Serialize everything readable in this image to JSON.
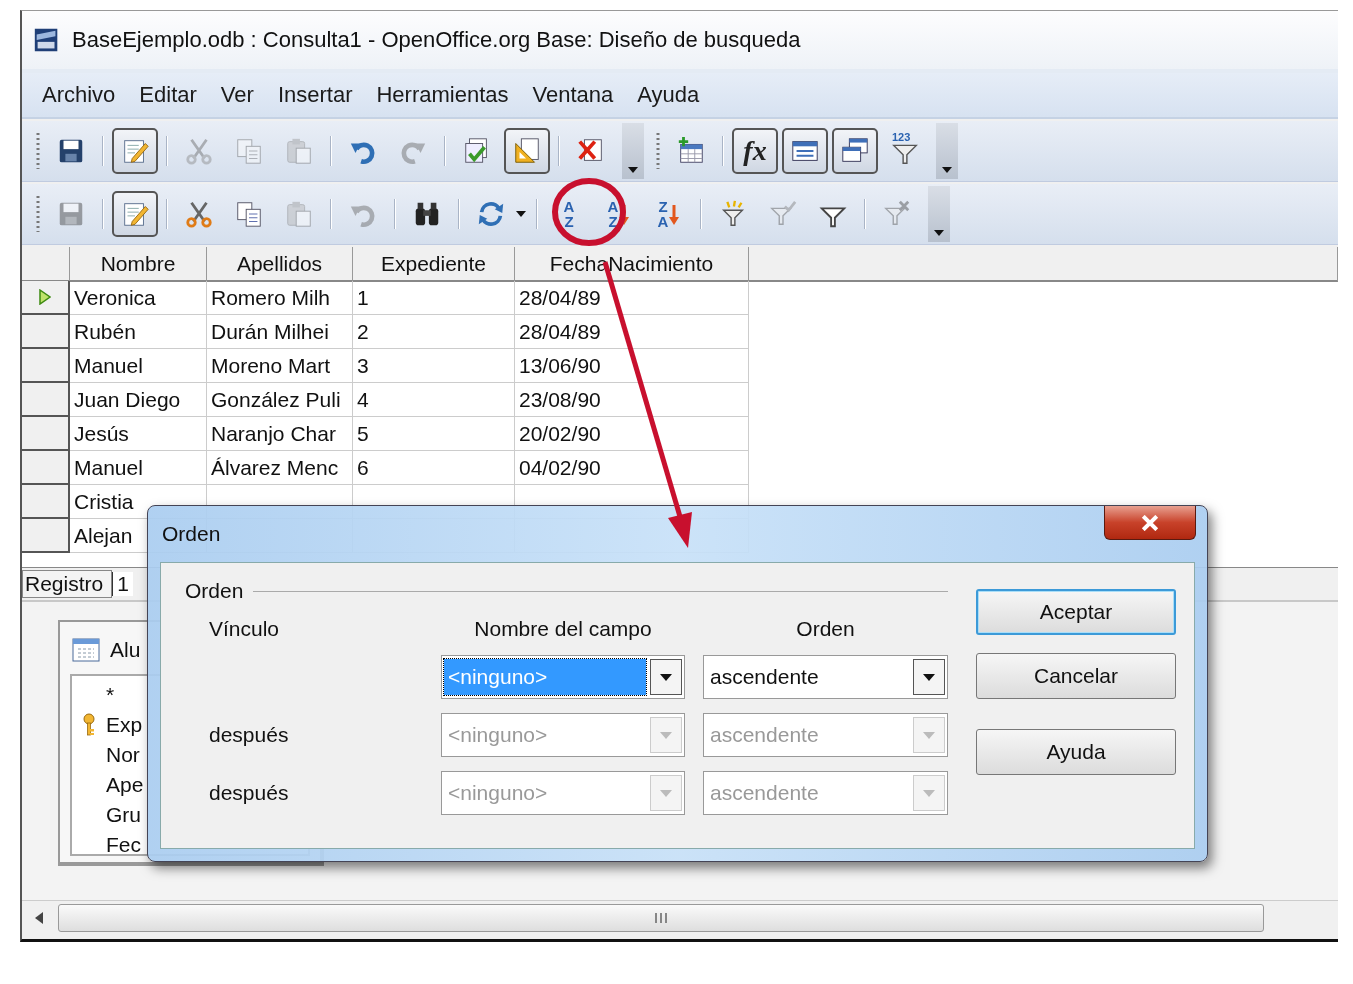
{
  "window": {
    "title": "BaseEjemplo.odb : Consulta1 - OpenOffice.org Base: Diseño de busqueda"
  },
  "menu": [
    "Archivo",
    "Editar",
    "Ver",
    "Insertar",
    "Herramientas",
    "Ventana",
    "Ayuda"
  ],
  "toolbars": [
    [
      {
        "kind": "grip"
      },
      {
        "kind": "save",
        "on": false,
        "disabled": false
      },
      {
        "kind": "separator"
      },
      {
        "kind": "edit",
        "on": true,
        "disabled": false
      },
      {
        "kind": "separator"
      },
      {
        "kind": "cut",
        "on": false,
        "disabled": true
      },
      {
        "kind": "copy",
        "on": false,
        "disabled": true
      },
      {
        "kind": "paste",
        "on": false,
        "disabled": true
      },
      {
        "kind": "separator"
      },
      {
        "kind": "undo",
        "on": false,
        "disabled": false
      },
      {
        "kind": "redo",
        "on": false,
        "disabled": true
      },
      {
        "kind": "separator"
      },
      {
        "kind": "run",
        "on": false,
        "disabled": false
      },
      {
        "kind": "design",
        "on": true,
        "disabled": false
      },
      {
        "kind": "separator"
      },
      {
        "kind": "delete",
        "on": false,
        "disabled": false
      },
      {
        "kind": "overflow"
      },
      {
        "kind": "grip"
      },
      {
        "kind": "addtable",
        "on": false,
        "disabled": false
      },
      {
        "kind": "separator"
      },
      {
        "kind": "function",
        "on": true,
        "disabled": false,
        "glyphs": [
          "fx"
        ]
      },
      {
        "kind": "alias",
        "on": true,
        "disabled": false
      },
      {
        "kind": "tablename",
        "on": true,
        "disabled": false
      },
      {
        "kind": "numfilter",
        "on": false,
        "disabled": false,
        "glyphs": [
          "123"
        ]
      },
      {
        "kind": "overflow"
      }
    ],
    [
      {
        "kind": "grip"
      },
      {
        "kind": "save",
        "on": false,
        "disabled": true
      },
      {
        "kind": "separator"
      },
      {
        "kind": "edit",
        "on": true,
        "disabled": false
      },
      {
        "kind": "separator"
      },
      {
        "kind": "cut",
        "on": false,
        "disabled": false
      },
      {
        "kind": "copy",
        "on": false,
        "disabled": false
      },
      {
        "kind": "paste",
        "on": false,
        "disabled": true
      },
      {
        "kind": "separator"
      },
      {
        "kind": "undo",
        "on": false,
        "disabled": true
      },
      {
        "kind": "separator"
      },
      {
        "kind": "find",
        "on": false,
        "disabled": false
      },
      {
        "kind": "separator"
      },
      {
        "kind": "refresh",
        "on": false,
        "disabled": false
      },
      {
        "kind": "dropdown"
      },
      {
        "kind": "separator"
      },
      {
        "kind": "sort",
        "on": false,
        "disabled": false,
        "glyphs": [
          "A",
          "Z"
        ]
      },
      {
        "kind": "sortasc",
        "on": false,
        "disabled": false,
        "glyphs": [
          "A",
          "Z"
        ]
      },
      {
        "kind": "sortdesc",
        "on": false,
        "disabled": false,
        "glyphs": [
          "Z",
          "A"
        ]
      },
      {
        "kind": "separator"
      },
      {
        "kind": "autofilter",
        "on": false,
        "disabled": false
      },
      {
        "kind": "stdfilter",
        "on": false,
        "disabled": true
      },
      {
        "kind": "filter",
        "on": false,
        "disabled": false
      },
      {
        "kind": "separator"
      },
      {
        "kind": "removefilter",
        "on": false,
        "disabled": true
      },
      {
        "kind": "overflow"
      }
    ]
  ],
  "grid": {
    "columns": [
      "Nombre",
      "Apellidos",
      "Expediente",
      "FechaNacimiento"
    ],
    "rows": [
      {
        "current": true,
        "cells": [
          "Veronica",
          "Romero Milh",
          "1",
          "28/04/89"
        ]
      },
      {
        "current": false,
        "cells": [
          "Rubén",
          "Durán Milhei",
          "2",
          "28/04/89"
        ]
      },
      {
        "current": false,
        "cells": [
          "Manuel",
          "Moreno Mart",
          "3",
          "13/06/90"
        ]
      },
      {
        "current": false,
        "cells": [
          "Juan Diego",
          "González Puli",
          "4",
          "23/08/90"
        ]
      },
      {
        "current": false,
        "cells": [
          "Jesús",
          "Naranjo Char",
          "5",
          "20/02/90"
        ]
      },
      {
        "current": false,
        "cells": [
          "Manuel",
          "Álvarez Menc",
          "6",
          "04/02/90"
        ]
      },
      {
        "current": false,
        "cells": [
          "Cristia"
        ]
      },
      {
        "current": false,
        "cells": [
          "Alejan"
        ]
      }
    ]
  },
  "record_bar": {
    "label": "Registro",
    "value": "1"
  },
  "table_box": {
    "title": "Alu",
    "fields": [
      {
        "name": "*",
        "key": false
      },
      {
        "name": "Exp",
        "key": true
      },
      {
        "name": "Nor",
        "key": false
      },
      {
        "name": "Ape",
        "key": false
      },
      {
        "name": "Gru",
        "key": false
      },
      {
        "name": "Fec",
        "key": false
      }
    ]
  },
  "dialog": {
    "title": "Orden",
    "group": "Orden",
    "headers": [
      "Vínculo",
      "Nombre del campo",
      "Orden"
    ],
    "rows": [
      {
        "field": "<ninguno>",
        "order": "ascendente",
        "disabled": false,
        "focused": true
      },
      {
        "label": "después",
        "field": "<ninguno>",
        "order": "ascendente",
        "disabled": true,
        "focused": false
      },
      {
        "label": "después",
        "field": "<ninguno>",
        "order": "ascendente",
        "disabled": true,
        "focused": false
      }
    ],
    "buttons": [
      {
        "label": "Aceptar",
        "default": true
      },
      {
        "label": "Cancelar",
        "default": false
      },
      {
        "label": "Ayuda",
        "default": false
      }
    ]
  }
}
